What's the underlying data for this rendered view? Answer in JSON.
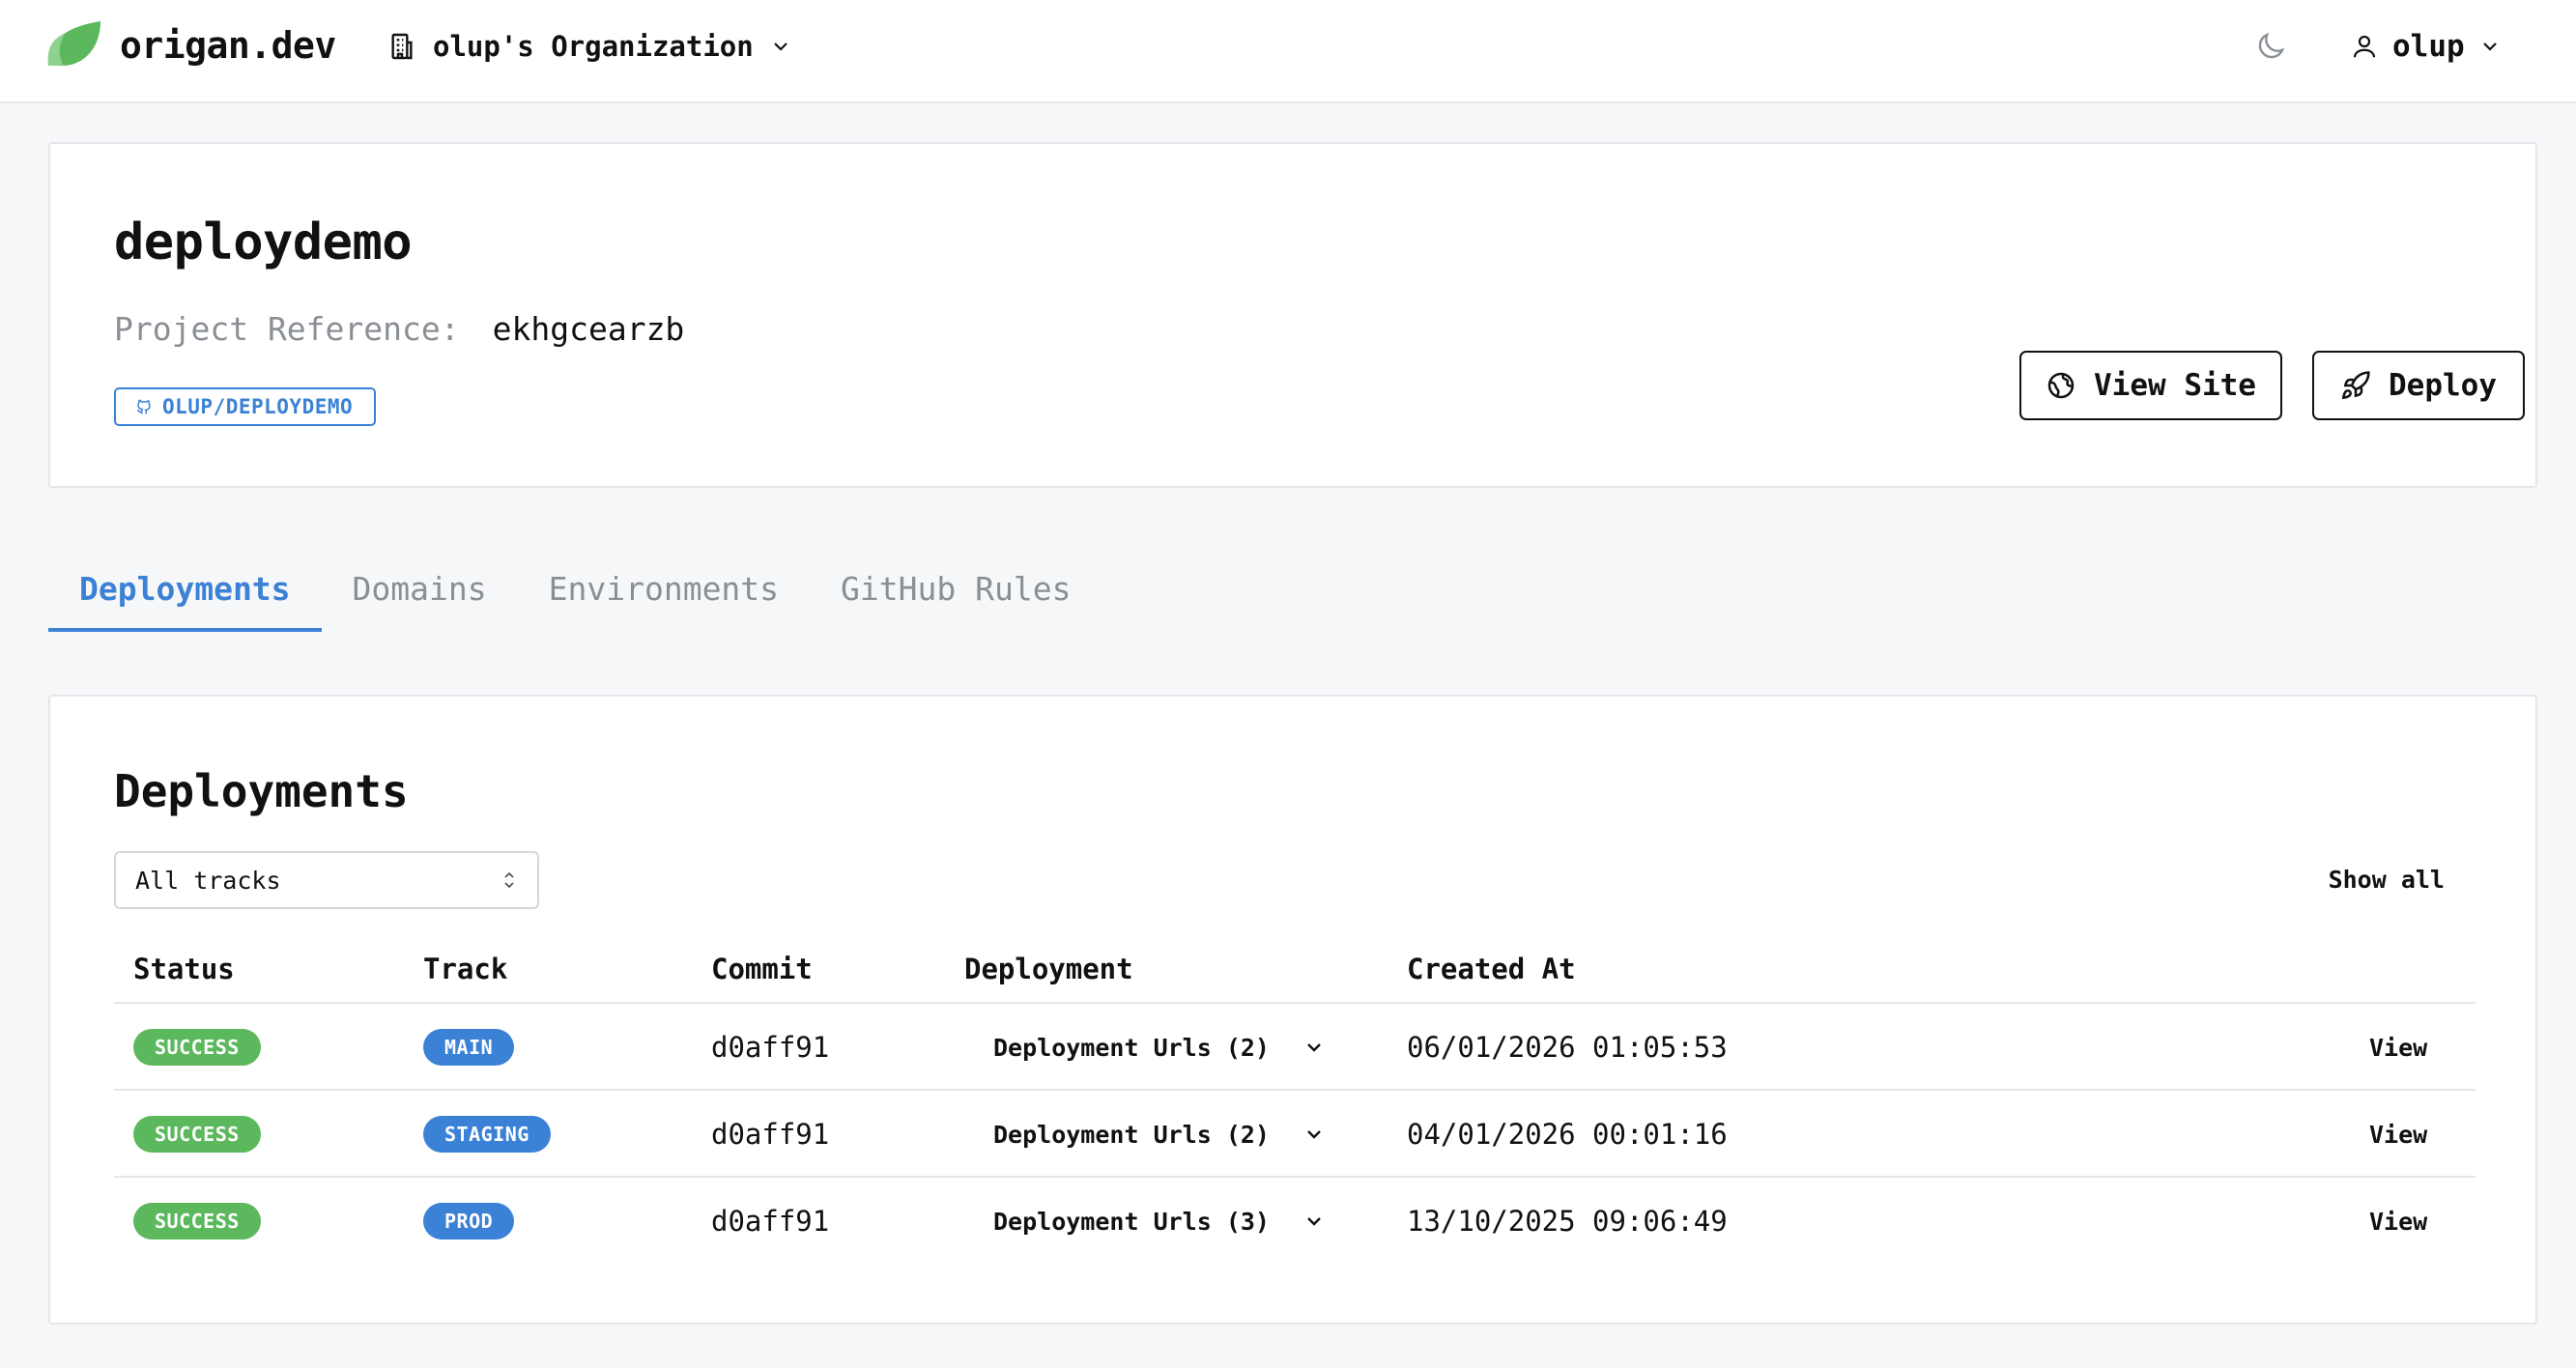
{
  "header": {
    "brand": "origan.dev",
    "organization": "olup's Organization",
    "user": "olup"
  },
  "project": {
    "name": "deploydemo",
    "reference_label": "Project Reference:",
    "reference_value": "ekhgcearzb",
    "repo": "OLUP/DEPLOYDEMO",
    "view_site_label": "View Site",
    "deploy_label": "Deploy"
  },
  "tabs": [
    {
      "label": "Deployments",
      "active": true
    },
    {
      "label": "Domains",
      "active": false
    },
    {
      "label": "Environments",
      "active": false
    },
    {
      "label": "GitHub Rules",
      "active": false
    }
  ],
  "deployments": {
    "title": "Deployments",
    "track_filter": "All tracks",
    "show_all_label": "Show all",
    "columns": [
      "Status",
      "Track",
      "Commit",
      "Deployment",
      "Created At"
    ],
    "rows": [
      {
        "status": "SUCCESS",
        "track": "MAIN",
        "commit": "d0aff91",
        "deployment": "Deployment Urls (2)",
        "created_at": "06/01/2026 01:05:53",
        "action": "View"
      },
      {
        "status": "SUCCESS",
        "track": "STAGING",
        "commit": "d0aff91",
        "deployment": "Deployment Urls (2)",
        "created_at": "04/01/2026 00:01:16",
        "action": "View"
      },
      {
        "status": "SUCCESS",
        "track": "PROD",
        "commit": "d0aff91",
        "deployment": "Deployment Urls (3)",
        "created_at": "13/10/2025 09:06:49",
        "action": "View"
      }
    ]
  },
  "colors": {
    "accent": "#3b82d6",
    "success": "#5cb85c",
    "logo": "#5cb85c"
  }
}
